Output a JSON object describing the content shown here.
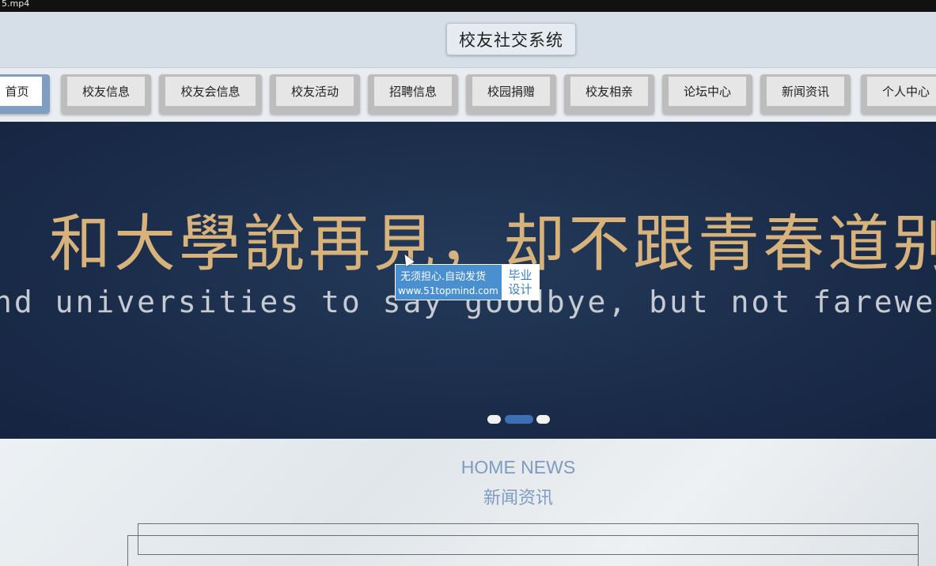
{
  "player": {
    "title": "5.mp4"
  },
  "header": {
    "title": "校友社交系统"
  },
  "nav": {
    "items": [
      {
        "label": "首页"
      },
      {
        "label": "校友信息"
      },
      {
        "label": "校友会信息"
      },
      {
        "label": "校友活动"
      },
      {
        "label": "招聘信息"
      },
      {
        "label": "校园捐赠"
      },
      {
        "label": "校友相亲"
      },
      {
        "label": "论坛中心"
      },
      {
        "label": "新闻资讯"
      },
      {
        "label": "个人中心"
      }
    ],
    "active_index": 0
  },
  "banner": {
    "headline_cn": "和大學說再見，却不跟青春道别",
    "headline_en": "nd universities to say goodbye, but not farewell with y",
    "slides": 3,
    "active_slide": 2
  },
  "watermark": {
    "line1": "无须担心.自动发货",
    "line2": "www.51topmind.com",
    "badge_line1": "毕业",
    "badge_line2": "设计"
  },
  "news_section": {
    "title_en": "HOME NEWS",
    "title_cn": "新闻资讯"
  },
  "colors": {
    "accent": "#7d9bc3",
    "active_nav": "#7f9ec2",
    "banner_bg": "#1b2d4b",
    "banner_text": "#d7b27a"
  }
}
